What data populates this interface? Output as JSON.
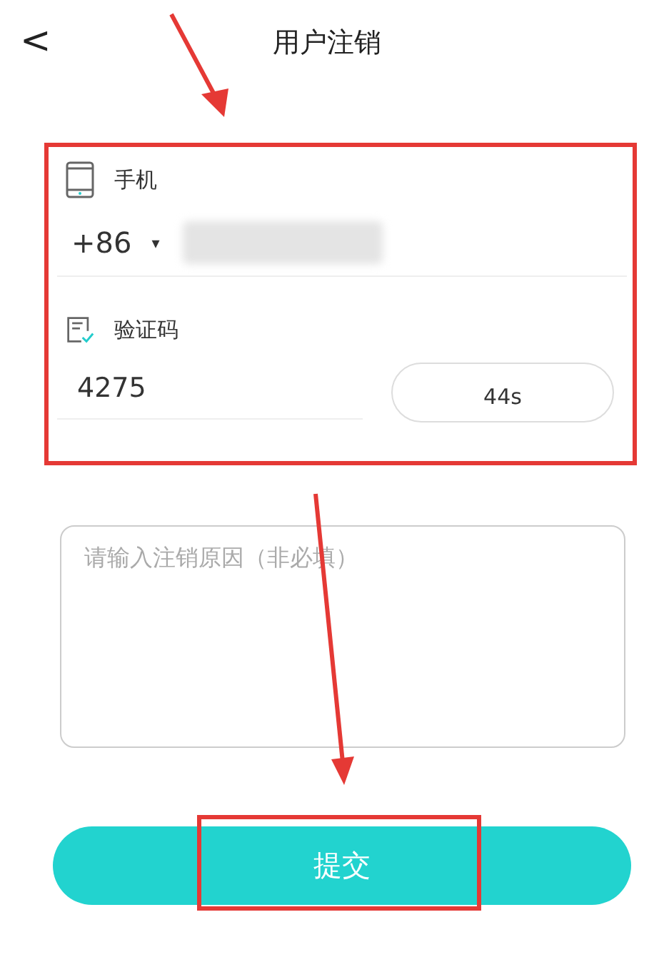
{
  "header": {
    "back": "<",
    "title": "用户注销"
  },
  "phone": {
    "label": "手机",
    "country_code": "+86",
    "caret": "▾"
  },
  "code": {
    "label": "验证码",
    "value": "4275",
    "countdown": "44s"
  },
  "reason": {
    "placeholder": "请输入注销原因（非必填）"
  },
  "submit": {
    "label": "提交"
  }
}
